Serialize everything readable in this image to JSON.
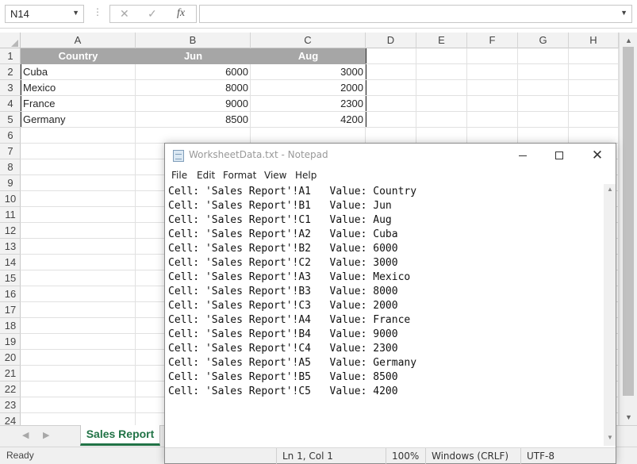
{
  "excel": {
    "name_box": "N14",
    "formula_bar": {
      "cancel_icon": "✕",
      "enter_icon": "✓",
      "fx_label": "fx",
      "content": ""
    },
    "columns": [
      "A",
      "B",
      "C",
      "D",
      "E",
      "F",
      "G",
      "H"
    ],
    "rows": [
      "1",
      "2",
      "3",
      "4",
      "5",
      "6",
      "7",
      "8",
      "9",
      "10",
      "11",
      "12",
      "13",
      "14",
      "15",
      "16",
      "17",
      "18",
      "19",
      "20",
      "21",
      "22",
      "23",
      "24"
    ],
    "table": {
      "headers": [
        "Country",
        "Jun",
        "Aug"
      ],
      "data": [
        [
          "Cuba",
          "6000",
          "3000"
        ],
        [
          "Mexico",
          "8000",
          "2000"
        ],
        [
          "France",
          "9000",
          "2300"
        ],
        [
          "Germany",
          "8500",
          "4200"
        ]
      ]
    },
    "sheet_tab": "Sales Report",
    "status": "Ready",
    "header_fill": "#a6a6a6",
    "tab_accent": "#217346"
  },
  "notepad": {
    "title": "WorksheetData.txt - Notepad",
    "menu": [
      "File",
      "Edit",
      "Format",
      "View",
      "Help"
    ],
    "lines": [
      "Cell: 'Sales Report'!A1   Value: Country",
      "Cell: 'Sales Report'!B1   Value: Jun",
      "Cell: 'Sales Report'!C1   Value: Aug",
      "Cell: 'Sales Report'!A2   Value: Cuba",
      "Cell: 'Sales Report'!B2   Value: 6000",
      "Cell: 'Sales Report'!C2   Value: 3000",
      "Cell: 'Sales Report'!A3   Value: Mexico",
      "Cell: 'Sales Report'!B3   Value: 8000",
      "Cell: 'Sales Report'!C3   Value: 2000",
      "Cell: 'Sales Report'!A4   Value: France",
      "Cell: 'Sales Report'!B4   Value: 9000",
      "Cell: 'Sales Report'!C4   Value: 2300",
      "Cell: 'Sales Report'!A5   Value: Germany",
      "Cell: 'Sales Report'!B5   Value: 8500",
      "Cell: 'Sales Report'!C5   Value: 4200"
    ],
    "status": {
      "position": "Ln 1, Col 1",
      "zoom": "100%",
      "line_endings": "Windows (CRLF)",
      "encoding": "UTF-8"
    }
  }
}
